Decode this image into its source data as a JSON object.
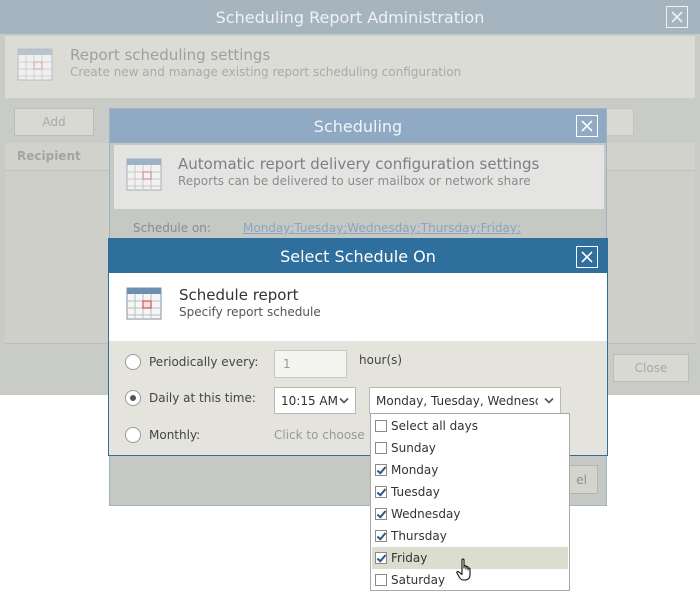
{
  "admin_window": {
    "title": "Scheduling Report Administration",
    "section_title": "Report scheduling settings",
    "section_subtitle": "Create new and manage existing report scheduling configuration",
    "add_button": "Add",
    "column_recipient": "Recipient",
    "close_button": "Close"
  },
  "scheduling_window": {
    "title": "Scheduling",
    "section_title": "Automatic report delivery configuration settings",
    "section_subtitle": "Reports can be delivered to user mailbox or network share",
    "schedule_on_label": "Schedule on:",
    "schedule_on_value": "Monday;Tuesday;Wednesday;Thursday;Friday;",
    "cancel_button_partial": "el"
  },
  "select_schedule_window": {
    "title": "Select Schedule On",
    "section_title": "Schedule report",
    "section_subtitle": "Specify report schedule",
    "periodically_label": "Periodically every:",
    "periodically_value": "1",
    "hours_unit": "hour(s)",
    "daily_label": "Daily at this time:",
    "daily_time": "10:15 AM",
    "days_selected": "Monday, Tuesday, Wednesday",
    "monthly_label": "Monthly:",
    "monthly_placeholder": "Click to choose",
    "selected_option": "daily"
  },
  "days_dropdown": {
    "items": [
      {
        "label": "Select all days",
        "checked": false
      },
      {
        "label": "Sunday",
        "checked": false
      },
      {
        "label": "Monday",
        "checked": true
      },
      {
        "label": "Tuesday",
        "checked": true
      },
      {
        "label": "Wednesday",
        "checked": true
      },
      {
        "label": "Thursday",
        "checked": true
      },
      {
        "label": "Friday",
        "checked": true
      },
      {
        "label": "Saturday",
        "checked": false
      }
    ],
    "hovered_index": 6
  },
  "colors": {
    "title_blue": "#2e6f9e",
    "dim_title": "#a6b4c0",
    "dim_panel": "#d9d9d2",
    "hover_row": "#dcdccf"
  }
}
